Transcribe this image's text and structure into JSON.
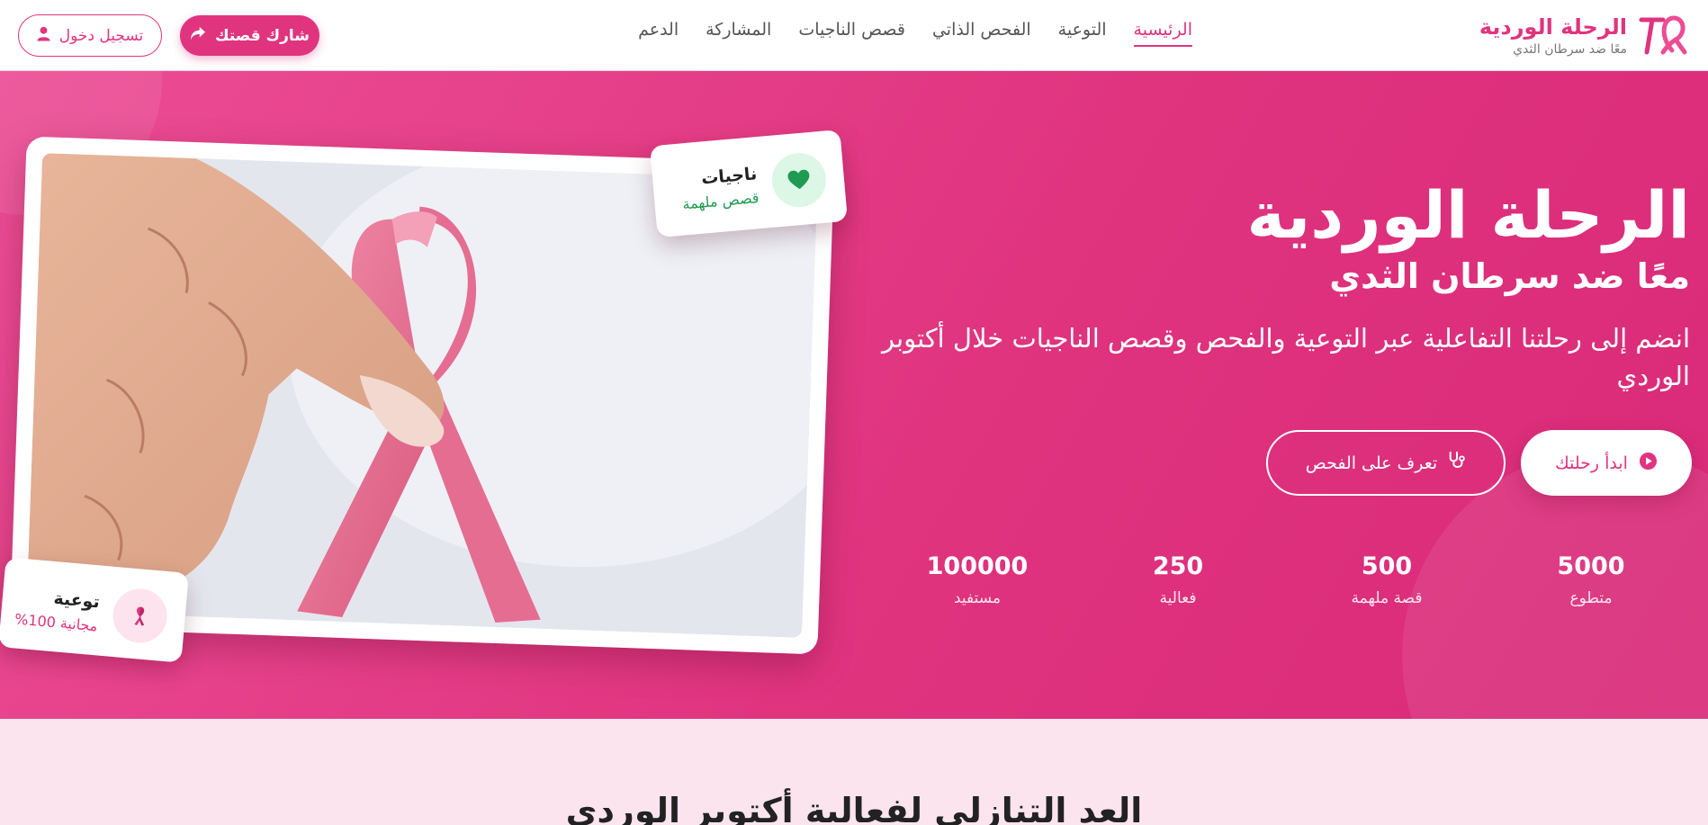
{
  "brand": {
    "title": "الرحلة الوردية",
    "subtitle": "معًا ضد سرطان الثدي"
  },
  "nav": {
    "items": [
      {
        "label": "الرئيسية",
        "active": true
      },
      {
        "label": "التوعية"
      },
      {
        "label": "الفحص الذاتي"
      },
      {
        "label": "قصص الناجيات"
      },
      {
        "label": "المشاركة"
      },
      {
        "label": "الدعم"
      }
    ]
  },
  "header": {
    "share_label": "شارك قصتك",
    "login_label": "تسجيل دخول"
  },
  "hero": {
    "title": "الرحلة الوردية",
    "subtitle": "معًا ضد سرطان الثدي",
    "description": "انضم إلى رحلتنا التفاعلية عبر التوعية والفحص وقصص الناجيات خلال أكتوبر الوردي",
    "start_label": "ابدأ رحلتك",
    "learn_label": "تعرف على الفحص",
    "stats": [
      {
        "value": "5000",
        "label": "متطوع"
      },
      {
        "value": "500",
        "label": "قصة ملهمة"
      },
      {
        "value": "250",
        "label": "فعالية"
      },
      {
        "value": "100000",
        "label": "مستفيد"
      }
    ],
    "badges": {
      "survivors": {
        "title": "ناجيات",
        "subtitle": "قصص ملهمة"
      },
      "awareness": {
        "title": "توعية",
        "subtitle": "مجانية 100%"
      }
    }
  },
  "countdown": {
    "title": "العد التنازلي لفعالية أكتوبر الوردي"
  },
  "colors": {
    "primary": "#e0347f",
    "hero_start": "#ec4d95",
    "hero_end": "#d92a78",
    "survivor_green": "#1f9a52",
    "section_bg": "#fbe4ee"
  },
  "icons": {
    "logo": "pink-ribbon-logo-icon",
    "share": "share-arrow-icon",
    "login": "user-icon",
    "start": "play-circle-icon",
    "learn": "stethoscope-icon",
    "survivors": "heart-icon",
    "awareness": "ribbon-icon"
  }
}
